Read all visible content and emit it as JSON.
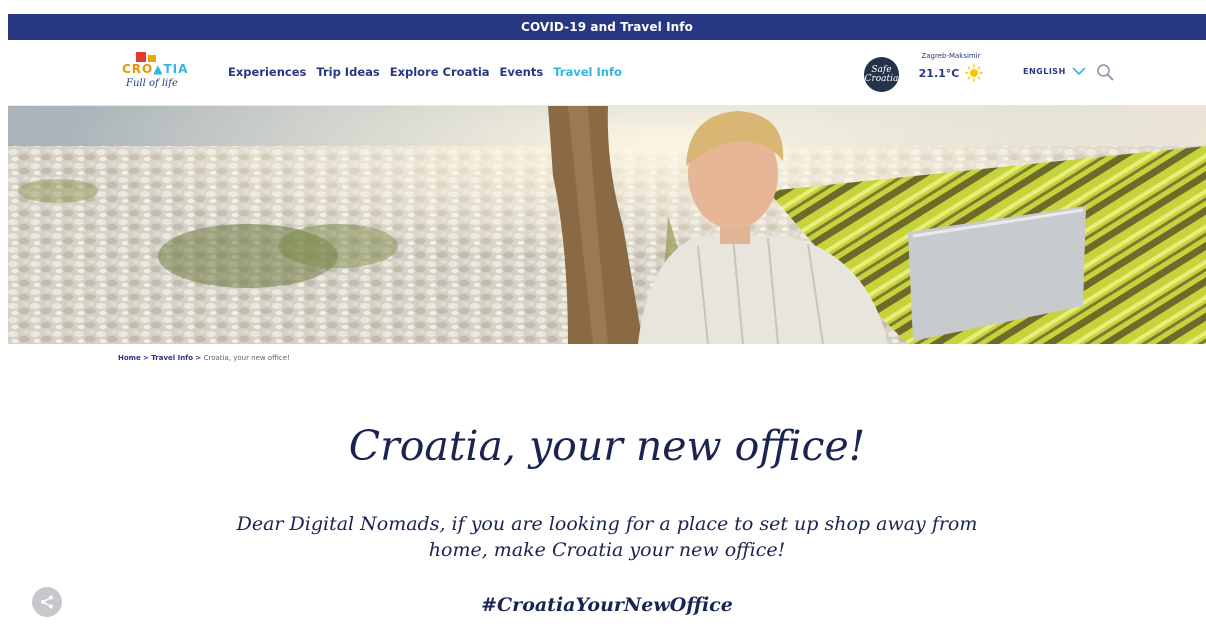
{
  "banner": {
    "text": "COVID-19 and Travel Info",
    "bg": "#283782"
  },
  "logo": {
    "word": "CRO▲TIA",
    "tagline": "Full of life"
  },
  "nav": {
    "items": [
      {
        "label": "Experiences"
      },
      {
        "label": "Trip Ideas"
      },
      {
        "label": "Explore Croatia"
      },
      {
        "label": "Events"
      },
      {
        "label": "Travel Info",
        "active": true
      }
    ],
    "active_color": "#2eb6e8",
    "text_color": "#283782"
  },
  "safe_badge": {
    "text": "Safe Croatia"
  },
  "weather": {
    "location": "Zagreb-Maksimir",
    "temperature": "21.1°C",
    "icon": "sun-icon"
  },
  "language": {
    "selected": "ENGLISH",
    "icon": "chevron-down-icon"
  },
  "search": {
    "icon": "search-icon"
  },
  "breadcrumb": {
    "home": "Home",
    "separator": ">",
    "section": "Travel Info",
    "current": "Croatia, your new office!"
  },
  "page": {
    "title": "Croatia, your new office!",
    "intro": "Dear Digital Nomads, if you are looking for a place to set up shop away from home, make Croatia your new office!",
    "hashtag": "#CroatiaYourNewOffice"
  },
  "share": {
    "icon": "share-icon"
  }
}
